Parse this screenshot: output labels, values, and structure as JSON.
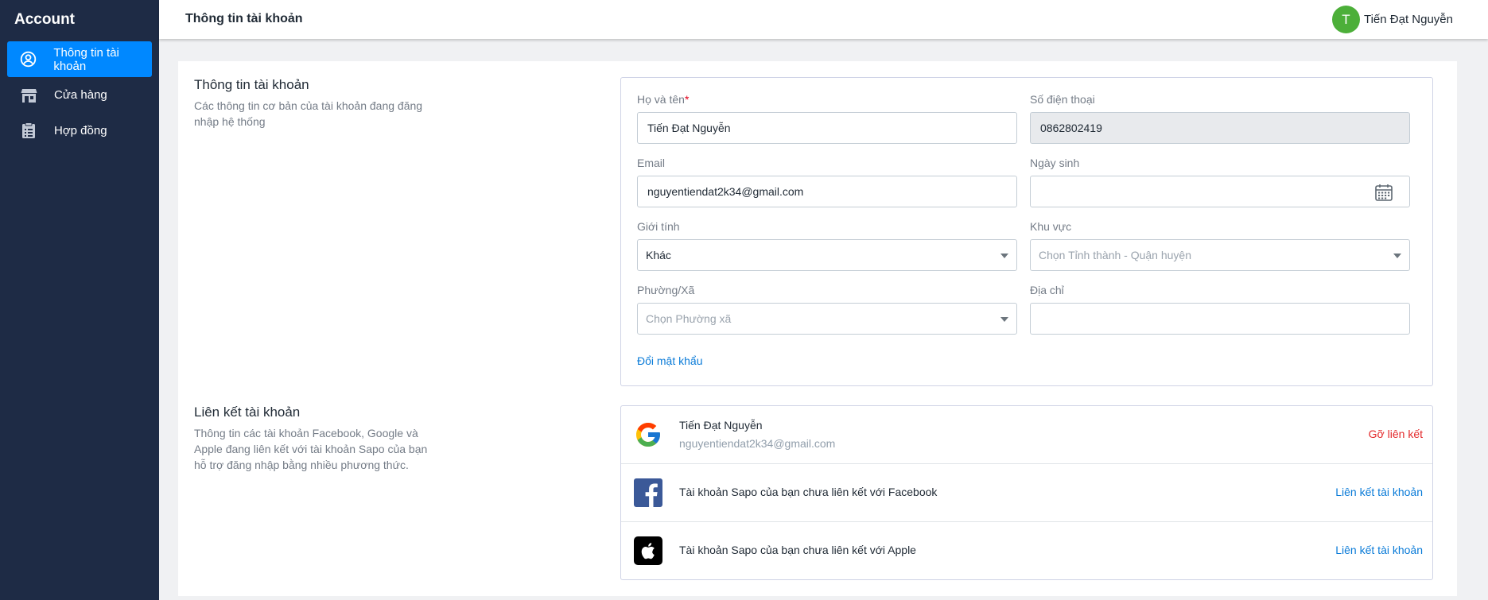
{
  "sidebar": {
    "app_title": "Account",
    "items": [
      {
        "label": "Thông tin tài khoản",
        "icon": "user-circle-icon",
        "active": true
      },
      {
        "label": "Cửa hàng",
        "icon": "store-icon",
        "active": false
      },
      {
        "label": "Hợp đồng",
        "icon": "contract-icon",
        "active": false
      }
    ]
  },
  "header": {
    "title": "Thông tin tài khoản",
    "user": {
      "initial": "T",
      "name": "Tiến Đạt Nguyễn"
    }
  },
  "account_section": {
    "title": "Thông tin tài khoản",
    "description": "Các thông tin cơ bản của tài khoản đang đăng nhập hệ thống"
  },
  "form": {
    "full_name": {
      "label": "Họ và tên",
      "required_mark": "*",
      "value": "Tiến Đạt Nguyễn"
    },
    "phone": {
      "label": "Số điện thoại",
      "value": "0862802419"
    },
    "email": {
      "label": "Email",
      "value": "nguyentiendat2k34@gmail.com"
    },
    "birthday": {
      "label": "Ngày sinh",
      "value": ""
    },
    "gender": {
      "label": "Giới tính",
      "value": "Khác"
    },
    "region": {
      "label": "Khu vực",
      "placeholder": "Chọn Tỉnh thành - Quận huyện"
    },
    "ward": {
      "label": "Phường/Xã",
      "placeholder": "Chọn Phường xã"
    },
    "address": {
      "label": "Địa chỉ",
      "value": ""
    },
    "change_password": "Đổi mật khẩu"
  },
  "links_section": {
    "title": "Liên kết tài khoản",
    "description": "Thông tin các tài khoản Facebook, Google và Apple đang liên kết với tài khoản Sapo của bạn hỗ trợ đăng nhập bằng nhiều phương thức."
  },
  "links": {
    "google": {
      "name": "Tiến Đạt Nguyễn",
      "email": "nguyentiendat2k34@gmail.com",
      "action": "Gỡ liên kết"
    },
    "facebook": {
      "text": "Tài khoản Sapo của bạn chưa liên kết với Facebook",
      "action": "Liên kết tài khoản"
    },
    "apple": {
      "text": "Tài khoản Sapo của bạn chưa liên kết với Apple",
      "action": "Liên kết tài khoản"
    }
  },
  "colors": {
    "sidebar_bg": "#1e2b45",
    "accent": "#0088ff",
    "link": "#0a7bd8",
    "danger": "#e3282a",
    "avatar": "#4caf39"
  }
}
